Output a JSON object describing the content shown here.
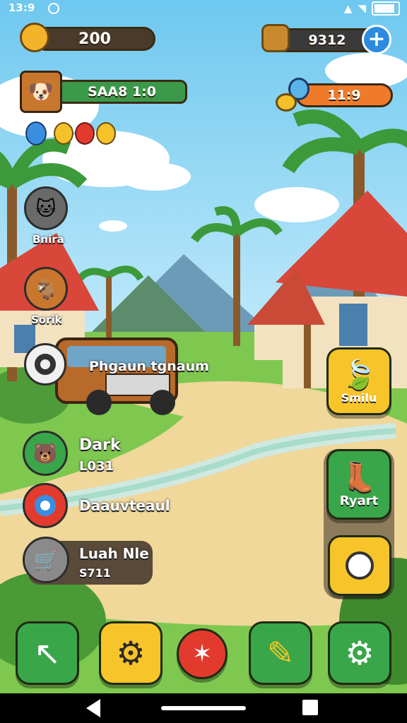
{
  "status_bar": {
    "time": "13:9"
  },
  "hud": {
    "coins": "200",
    "gems": "9312",
    "level_label": "SAA8 1:0",
    "timer": "11:9",
    "add_symbol": "+"
  },
  "colors": {
    "green": "#3aa64a",
    "orange": "#ef7a2a",
    "yellow": "#f7c52a",
    "red": "#e23b2e",
    "dark_pill": "#4a3a2a"
  },
  "left_menu": [
    {
      "label": "Bnira",
      "icon": "cat-face-icon"
    },
    {
      "label": "Sorik",
      "icon": "goat-icon"
    },
    {
      "label": "Phgaun tgnaum",
      "icon": "tire-icon"
    },
    {
      "label": "Dark",
      "sublabel": "L031",
      "icon": "bear-face-icon"
    },
    {
      "label": "Daauvteaul",
      "icon": "blue-ring-icon"
    },
    {
      "label": "Luah Nle",
      "sublabel": "S711",
      "icon": "cart-icon"
    }
  ],
  "right_menu": [
    {
      "label": "Smilu",
      "icon": "leaf-icon"
    },
    {
      "label": "Ryart",
      "icon": "boot-icon"
    },
    {
      "label": "",
      "icon": "eye-icon"
    }
  ],
  "bottom_bar": [
    {
      "name": "arrow-button",
      "icon": "arrow-icon"
    },
    {
      "name": "settings-frame-button",
      "icon": "frame-gear-icon"
    },
    {
      "name": "alert-button",
      "icon": "alert-icon"
    },
    {
      "name": "edit-button",
      "icon": "pencil-icon"
    },
    {
      "name": "gear-button",
      "icon": "gear-icon"
    }
  ]
}
